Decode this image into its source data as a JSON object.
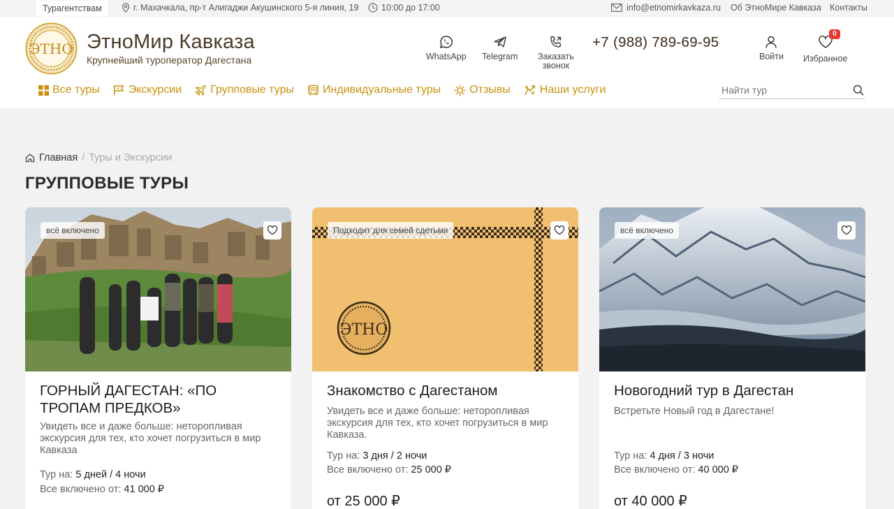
{
  "topbar": {
    "chip": "Турагентствам",
    "address": "г. Махачкала, пр-т Алигаджи Акушинского 5-я линия, 19",
    "hours": "10:00 до 17:00",
    "email": "info@etnomirkavkaza.ru",
    "about": "Об ЭтноМире Кавказа",
    "contacts": "Контакты"
  },
  "header": {
    "logo_text": "ЭТНО",
    "title": "ЭтноМир Кавказа",
    "subtitle": "Крупнейший туроператор Дагестана",
    "whatsapp": "WhatsApp",
    "telegram": "Telegram",
    "callback_line1": "Заказать",
    "callback_line2": "звонок",
    "phone": "+7 (988) 789-69-95",
    "login": "Войти",
    "favorites": "Избранное",
    "favorites_count": "0"
  },
  "nav": {
    "items": [
      {
        "label": "Все туры",
        "icon": "grid-icon"
      },
      {
        "label": "Экскурсии",
        "icon": "flag-icon"
      },
      {
        "label": "Групповые туры",
        "icon": "plane-icon"
      },
      {
        "label": "Индивидуальные туры",
        "icon": "bus-icon"
      },
      {
        "label": "Отзывы",
        "icon": "sun-icon"
      },
      {
        "label": "Наши услуги",
        "icon": "services-icon"
      }
    ],
    "search_placeholder": "Найти тур"
  },
  "breadcrumb": {
    "home": "Главная",
    "separator": "/",
    "current": "Туры и Экскурсии"
  },
  "page_title": "ГРУППОВЫЕ ТУРЫ",
  "cards": [
    {
      "tag": "всё включено",
      "title": "ГОРНЫЙ ДАГЕСТАН: «ПО ТРОПАМ ПРЕДКОВ»",
      "description": "Увидеть все и даже больше: неторопливая экскурсия для тех, кто хочет погрузиться в мир Кавказа",
      "duration_label": "Тур на:",
      "duration": "5 дней / 4 ночи",
      "price_label": "Все включено от:",
      "price_value": "41 000 ₽",
      "price_big": ""
    },
    {
      "tag": "Подходит для семей сдетьми",
      "title": "Знакомство с Дагестаном",
      "description": "Увидеть все и даже больше: неторопливая экскурсия для тех, кто хочет погрузиться в мир Кавказа.",
      "duration_label": "Тур на:",
      "duration": "3 дня / 2 ночи",
      "price_label": "Все включено от:",
      "price_value": "25 000 ₽",
      "price_big": "от 25 000 ₽"
    },
    {
      "tag": "всё включено",
      "title": "Новогодний тур в Дагестан",
      "description": "Встретьте Новый год в Дагестане!",
      "duration_label": "Тур на:",
      "duration": "4 дня / 3 ночи",
      "price_label": "Все включено от:",
      "price_value": "40 000 ₽",
      "price_big": "от 40 000 ₽"
    }
  ],
  "colors": {
    "accent": "#c8920e",
    "brand_brown": "#4a3a2a",
    "badge_red": "#e53935",
    "card_beige": "#f0c070"
  }
}
